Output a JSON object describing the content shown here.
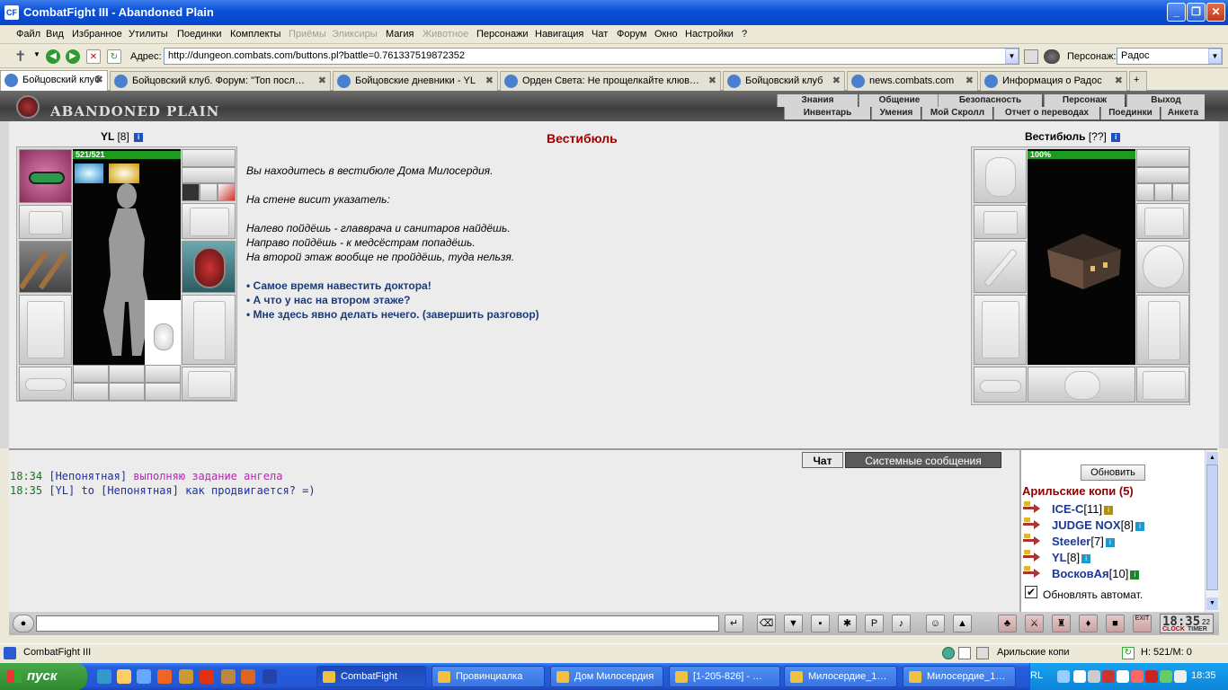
{
  "window": {
    "title": "CombatFight III - Abandoned Plain",
    "app_icon": "CF"
  },
  "menu": [
    "Файл",
    "Вид",
    "Избранное",
    "Утилиты",
    "Поединки",
    "Комплекты",
    "Приёмы",
    "Эликсиры",
    "Магия",
    "Животное",
    "Персонажи",
    "Навигация",
    "Чат",
    "Форум",
    "Окно",
    "Настройки",
    "?"
  ],
  "menu_disabled": [
    "Приёмы",
    "Эликсиры",
    "Животное"
  ],
  "address": {
    "label": "Адрес:",
    "url": "http://dungeon.combats.com/buttons.pl?battle=0.761337519872352",
    "person_label": "Персонаж:",
    "person_value": "Рaдoc"
  },
  "tabs": [
    {
      "label": "Бойцовский клуб",
      "active": true
    },
    {
      "label": "Бойцовский клуб. Форум: \"Топ посл…"
    },
    {
      "label": "Бойцовские дневники - YL"
    },
    {
      "label": "Орден Света: Не прощелкайте клюв…"
    },
    {
      "label": "Бойцовский клуб"
    },
    {
      "label": "news.combats.com"
    },
    {
      "label": "Информация о Радос"
    }
  ],
  "game": {
    "title": "ABANDONED PLAIN",
    "nav_top": [
      "Знания",
      "Общение",
      "Безопасность",
      "Персонаж",
      "Выход"
    ],
    "nav_bottom": [
      "Инвентарь",
      "Умения",
      "Мой Скролл",
      "Отчет о переводах",
      "Поединки",
      "Анкета"
    ],
    "player": {
      "name": "YL",
      "level": "[8]",
      "hp": "521/521",
      "hp_fraction": 1.0
    },
    "npc": {
      "name": "Вестибюль",
      "level": "[??]",
      "hp": "100%",
      "hp_fraction": 1.0
    },
    "room_title": "Вестибюль",
    "story": [
      "Вы находитесь в вестибюле Дома Милосердия.",
      "На стене висит указатель:",
      "Налево пойдёшь - главврача и санитаров найдёшь.",
      "Направо пойдёшь - к медсёстрам попадёшь.",
      "На второй этаж вообще не пройдёшь, туда нельзя."
    ],
    "choices": [
      "Самое время навестить доктора!",
      "А что у нас на втором этаже?",
      "Мне здесь явно делать нечего. (завершить разговор)"
    ]
  },
  "chat": {
    "tabs": [
      "Чат",
      "Системные сообщения"
    ],
    "lines": [
      {
        "time": "18:34",
        "who": "[Непонятная]",
        "text": "выполняю задание ангела",
        "color": "#c020c0"
      },
      {
        "time": "18:35",
        "who": "[YL]",
        "text": "to [Непонятная] как продвигается? =)",
        "color": "#1c2fa0"
      }
    ]
  },
  "online": {
    "refresh": "Обновить",
    "location": "Арильские копи (5)",
    "members": [
      {
        "name": "ICE-C",
        "level": "[11]",
        "badge": "yellow"
      },
      {
        "name": "JUDGE NOX",
        "level": "[8]",
        "badge": "cyan"
      },
      {
        "name": "Steeler",
        "level": "[7]",
        "badge": "cyan"
      },
      {
        "name": "YL",
        "level": "[8]",
        "badge": "cyan"
      },
      {
        "name": "ВосковАя",
        "level": "[10]",
        "badge": "green"
      }
    ],
    "auto": "Обновлять автомат."
  },
  "clock": {
    "time": "18:35",
    "seconds": "22",
    "clock_label": "CLOCK",
    "timer_label": "TIMER"
  },
  "statusbar": {
    "app": "CombatFight III",
    "location": "Арильские копи",
    "hp": "H: 521/M: 0"
  },
  "taskbar": {
    "start": "пуск",
    "tasks": [
      "CombatFight",
      "Провинциалка",
      "Дом Милосердия",
      "[1-205-826] - …",
      "Милосердие_1…",
      "Милосердие_1…"
    ],
    "lang": "RL",
    "time": "18:35"
  },
  "colors": {
    "accent": "#a00000",
    "link": "#1c3a78",
    "xp_blue": "#0846c8"
  }
}
